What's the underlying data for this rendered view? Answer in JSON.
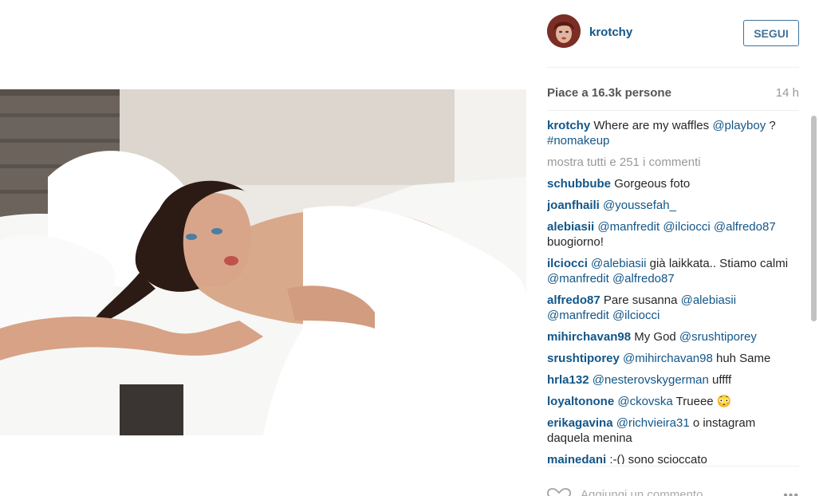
{
  "post": {
    "username": "krotchy",
    "follow_label": "SEGUI",
    "likes": "Piace a 16.3k persone",
    "time": "14 h",
    "show_all": "mostra tutti e 251 i commenti",
    "add_comment": "Aggiungi un commento...",
    "more": "•••"
  },
  "comments": [
    {
      "user": "krotchy",
      "parts": [
        {
          "t": "Where are my waffles "
        },
        {
          "t": "@playboy",
          "m": 1
        },
        {
          "t": " ? "
        },
        {
          "t": "#nomakeup",
          "m": 1
        }
      ]
    },
    {
      "user": "schubbube",
      "parts": [
        {
          "t": "Gorgeous foto"
        }
      ]
    },
    {
      "user": "joanfhaili",
      "parts": [
        {
          "t": "@youssefah_",
          "m": 1
        }
      ]
    },
    {
      "user": "alebiasii",
      "parts": [
        {
          "t": "@manfredit",
          "m": 1
        },
        {
          "t": " "
        },
        {
          "t": "@ilciocci",
          "m": 1
        },
        {
          "t": " "
        },
        {
          "t": "@alfredo87",
          "m": 1
        },
        {
          "t": " buogiorno!"
        }
      ]
    },
    {
      "user": "ilciocci",
      "parts": [
        {
          "t": "@alebiasii",
          "m": 1
        },
        {
          "t": " già laikkata.. Stiamo calmi "
        },
        {
          "t": "@manfredit",
          "m": 1
        },
        {
          "t": " "
        },
        {
          "t": "@alfredo87",
          "m": 1
        }
      ]
    },
    {
      "user": "alfredo87",
      "parts": [
        {
          "t": "Pare susanna "
        },
        {
          "t": "@alebiasii",
          "m": 1
        },
        {
          "t": " "
        },
        {
          "t": "@manfredit",
          "m": 1
        },
        {
          "t": " "
        },
        {
          "t": "@ilciocci",
          "m": 1
        }
      ]
    },
    {
      "user": "mihirchavan98",
      "parts": [
        {
          "t": "My God "
        },
        {
          "t": "@srushtiporey",
          "m": 1
        }
      ]
    },
    {
      "user": "srushtiporey",
      "parts": [
        {
          "t": "@mihirchavan98",
          "m": 1
        },
        {
          "t": " huh Same"
        }
      ]
    },
    {
      "user": "hrla132",
      "parts": [
        {
          "t": "@nesterovskygerman",
          "m": 1
        },
        {
          "t": " uffff"
        }
      ]
    },
    {
      "user": "loyaltonone",
      "parts": [
        {
          "t": "@ckovska",
          "m": 1
        },
        {
          "t": " Trueee 😳"
        }
      ]
    },
    {
      "user": "erikagavina",
      "parts": [
        {
          "t": "@richvieira31",
          "m": 1
        },
        {
          "t": " o instagram daquela menina"
        }
      ]
    },
    {
      "user": "mainedani",
      "parts": [
        {
          "t": ":-() sono scioccato"
        }
      ]
    }
  ],
  "icons": {
    "heart": "heart-icon",
    "avatar": "avatar"
  },
  "colors": {
    "link": "#125688",
    "follow": "#3f729b",
    "muted": "#999999"
  }
}
